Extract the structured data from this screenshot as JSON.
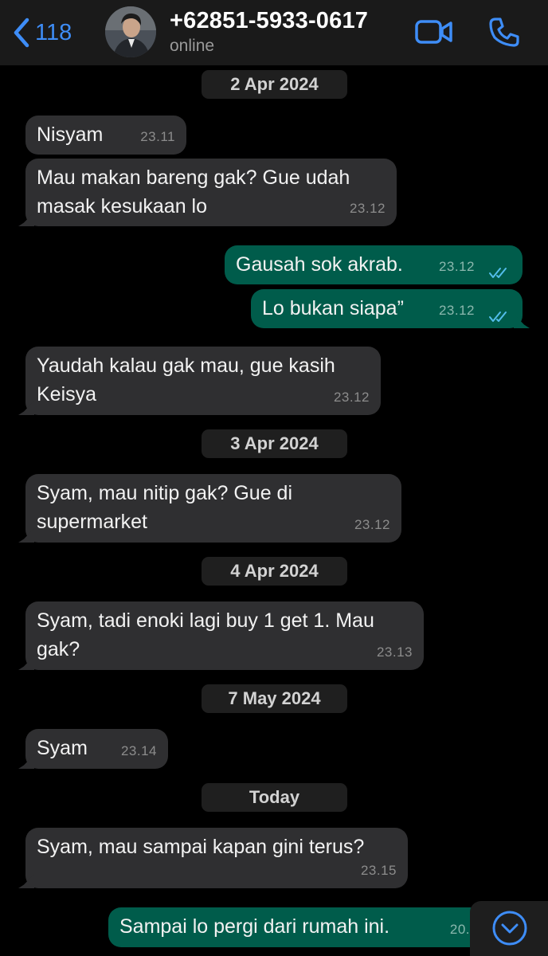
{
  "header": {
    "back_count": "118",
    "contact_name": "+62851-5933-0617",
    "status": "online",
    "icons": {
      "back": "chevron-left-icon",
      "video": "video-call-icon",
      "call": "phone-icon",
      "scroll": "chevron-down-icon"
    },
    "accent_color": "#3e8df7"
  },
  "dates": {
    "d1": "2 Apr 2024",
    "d2": "3 Apr 2024",
    "d3": "4 Apr 2024",
    "d4": "7 May 2024",
    "d5": "Today"
  },
  "messages": [
    {
      "dir": "in",
      "text": "Nisyam",
      "time": "23.11"
    },
    {
      "dir": "in",
      "text": "Mau makan bareng gak? Gue udah\nmasak kesukaan lo",
      "time": "23.12"
    },
    {
      "dir": "out",
      "text": "Gausah sok akrab.",
      "time": "23.12",
      "status": "read"
    },
    {
      "dir": "out",
      "text": "Lo bukan siapa”",
      "time": "23.12",
      "status": "read"
    },
    {
      "dir": "in",
      "text": "Yaudah kalau gak mau, gue kasih\nKeisya",
      "time": "23.12"
    },
    {
      "dir": "in",
      "text": "Syam, mau nitip gak? Gue di\nsupermarket",
      "time": "23.12"
    },
    {
      "dir": "in",
      "text": "Syam, tadi enoki lagi buy 1 get 1. Mau\ngak?",
      "time": "23.13"
    },
    {
      "dir": "in",
      "text": "Syam",
      "time": "23.14"
    },
    {
      "dir": "in",
      "text": "Syam, mau sampai kapan gini terus?",
      "time": "23.15"
    },
    {
      "dir": "out",
      "text": "Sampai lo pergi dari rumah ini.",
      "time": "20."
    }
  ],
  "colors": {
    "incoming_bubble": "#2f2f31",
    "outgoing_bubble": "#005c4b",
    "read_ticks": "#53bdeb",
    "background": "#000000"
  }
}
